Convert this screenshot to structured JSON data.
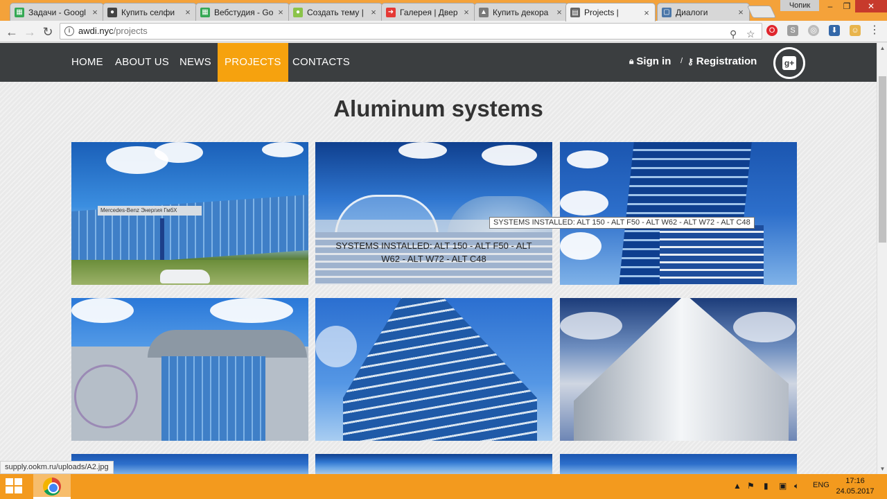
{
  "browser": {
    "tabs": [
      {
        "title": "Задачи - Googl",
        "favicon_color": "#34a853",
        "favicon_glyph": "▦"
      },
      {
        "title": "Купить селфи",
        "favicon_color": "#444444",
        "favicon_glyph": "●"
      },
      {
        "title": "Вебстудия - Go",
        "favicon_color": "#34a853",
        "favicon_glyph": "▦"
      },
      {
        "title": "Создать тему |",
        "favicon_color": "#8bc34a",
        "favicon_glyph": "●"
      },
      {
        "title": "Галерея | Двер",
        "favicon_color": "#e53935",
        "favicon_glyph": "➜"
      },
      {
        "title": "Купить декора",
        "favicon_color": "#7a7a7a",
        "favicon_glyph": "▲"
      },
      {
        "title": "Projects |",
        "favicon_color": "#666666",
        "favicon_glyph": "▤"
      },
      {
        "title": "Диалоги",
        "favicon_color": "#4a76a8",
        "favicon_glyph": "▢"
      }
    ],
    "active_tab_index": 6,
    "window_user": "Чопик",
    "url": {
      "host": "awdi.nyc",
      "path": "/projects"
    },
    "status_url": "supply.ookm.ru/uploads/A2.jpg"
  },
  "site": {
    "menu": [
      "HOME",
      "ABOUT US",
      "NEWS",
      "PROJECTS",
      "CONTACTS"
    ],
    "active_menu": "PROJECTS",
    "sign_in": "Sign in",
    "separator": "/",
    "registration": "Registration",
    "accent_color": "#f6a20e",
    "header_color": "#3b3e40"
  },
  "page": {
    "title": "Aluminum systems",
    "hover_caption": "SYSTEMS INSTALLED: ALT 150 - ALT F50 - ALT W62 - ALT W72 - ALT C48",
    "tooltip": "SYSTEMS INSTALLED: ALT 150 - ALT F50 - ALT W62 - ALT W72 - ALT C48",
    "sign_text": "Mercedes-Benz",
    "sign_text_2": "Энергия ГмбХ"
  },
  "taskbar": {
    "language": "ENG",
    "time": "17:16",
    "date": "24.05.2017"
  }
}
